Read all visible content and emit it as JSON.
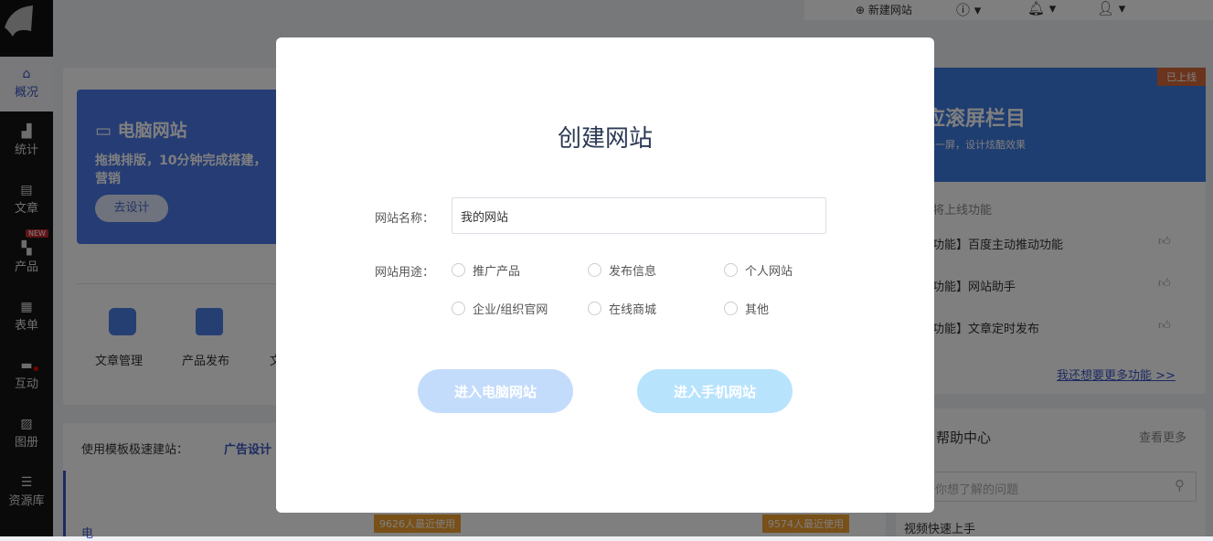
{
  "sidebar": {
    "items": [
      {
        "label": "概况",
        "icon": "home-icon"
      },
      {
        "label": "统计",
        "icon": "chart-icon"
      },
      {
        "label": "文章",
        "icon": "article-icon"
      },
      {
        "label": "产品",
        "icon": "product-icon",
        "badge": "NEW"
      },
      {
        "label": "表单",
        "icon": "form-icon"
      },
      {
        "label": "互动",
        "icon": "chat-icon"
      },
      {
        "label": "图册",
        "icon": "album-icon"
      },
      {
        "label": "资源库",
        "icon": "database-icon"
      }
    ]
  },
  "topbar": {
    "new_site": "新建网站"
  },
  "banner": {
    "title": "电脑网站",
    "desc": "拖拽排版，10分钟完成搭建，",
    "desc2": "营销",
    "button": "去设计"
  },
  "shortcuts": [
    "文章管理",
    "产品发布",
    "文"
  ],
  "templates": {
    "label": "使用模板极速建站：",
    "tab": "广告设计",
    "side": "电",
    "badges": [
      "9626人最近使用",
      "9574人最近使用"
    ]
  },
  "right": {
    "banner_title": "适应滚屏栏目",
    "banner_sub": "动切换一屏，设计炫酷效果",
    "badge": "已上线",
    "section": "将上线功能",
    "items": [
      "功能】百度主动推动功能",
      "功能】网站助手",
      "功能】文章定时发布"
    ],
    "more": "我还想要更多功能 >>"
  },
  "help": {
    "title": "帮助中心",
    "more": "查看更多",
    "search_placeholder": "你想了解的问题",
    "first": "视频快速上手"
  },
  "modal": {
    "title": "创建网站",
    "name_label": "网站名称：",
    "name_value": "我的网站",
    "purpose_label": "网站用途：",
    "options": [
      "推广产品",
      "发布信息",
      "个人网站",
      "企业/组织官网",
      "在线商城",
      "其他"
    ],
    "btn_pc": "进入电脑网站",
    "btn_mobile": "进入手机网站",
    "colors": {
      "btn_pc": "#c4dcfc",
      "btn_mobile": "#b8e3fd"
    }
  }
}
